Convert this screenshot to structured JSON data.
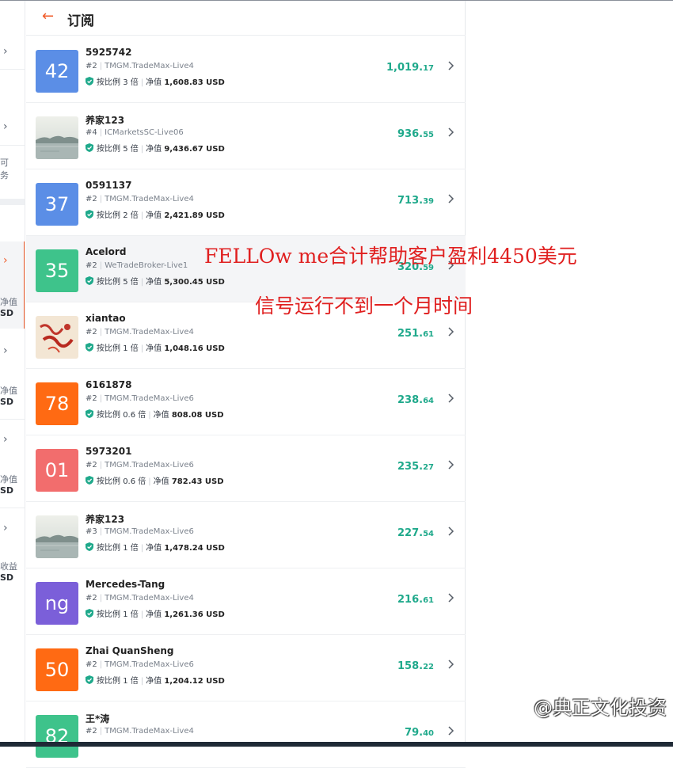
{
  "header": {
    "title": "订阅",
    "back_icon": "arrow-left-icon"
  },
  "labels": {
    "ratio_prefix": "按比例",
    "ratio_suffix": "倍",
    "equity_label": "净值"
  },
  "colors": {
    "accent": "#f05a28",
    "profit": "#1fa98b",
    "annotation": "#e02020"
  },
  "left_panel": {
    "frag_1": "可",
    "frag_2": "务",
    "frag_3": "净值",
    "frag_4": "SD",
    "frag_5": "净值",
    "frag_6": "SD",
    "frag_7": "净值",
    "frag_8": "SD",
    "frag_9": "收益",
    "frag_10": "SD"
  },
  "subscriptions": [
    {
      "avatar": "42",
      "avatar_color": "#5b8ee6",
      "name": "5925742",
      "rank": "#2",
      "server": "TMGM.TradeMax-Live4",
      "ratio": "3",
      "equity": "1,608.83 USD",
      "profit_int": "1,019.",
      "profit_dec": "17"
    },
    {
      "avatar": "photo-lake",
      "name": "养家123",
      "rank": "#4",
      "server": "ICMarketsSC-Live06",
      "ratio": "5",
      "equity": "9,436.67 USD",
      "profit_int": "936.",
      "profit_dec": "55"
    },
    {
      "avatar": "37",
      "avatar_color": "#5b8ee6",
      "name": "0591137",
      "rank": "#2",
      "server": "TMGM.TradeMax-Live4",
      "ratio": "2",
      "equity": "2,421.89 USD",
      "profit_int": "713.",
      "profit_dec": "39"
    },
    {
      "avatar": "35",
      "avatar_color": "#3ec38b",
      "name": "Acelord",
      "rank": "#2",
      "server": "WeTradeBroker-Live1",
      "ratio": "5",
      "equity": "5,300.45 USD",
      "profit_int": "320.",
      "profit_dec": "59"
    },
    {
      "avatar": "photo-calligraphy",
      "name": "xiantao",
      "rank": "#2",
      "server": "TMGM.TradeMax-Live4",
      "ratio": "1",
      "equity": "1,048.16 USD",
      "profit_int": "251.",
      "profit_dec": "61"
    },
    {
      "avatar": "78",
      "avatar_color": "#ff6a13",
      "name": "6161878",
      "rank": "#2",
      "server": "TMGM.TradeMax-Live6",
      "ratio": "0.6",
      "equity": "808.08 USD",
      "profit_int": "238.",
      "profit_dec": "64"
    },
    {
      "avatar": "01",
      "avatar_color": "#f26d6d",
      "name": "5973201",
      "rank": "#2",
      "server": "TMGM.TradeMax-Live6",
      "ratio": "0.6",
      "equity": "782.43 USD",
      "profit_int": "235.",
      "profit_dec": "27"
    },
    {
      "avatar": "photo-lake",
      "name": "养家123",
      "rank": "#3",
      "server": "TMGM.TradeMax-Live6",
      "ratio": "1",
      "equity": "1,478.24 USD",
      "profit_int": "227.",
      "profit_dec": "54"
    },
    {
      "avatar": "ng",
      "avatar_color": "#7b5fd9",
      "name": "Mercedes-Tang",
      "rank": "#2",
      "server": "TMGM.TradeMax-Live4",
      "ratio": "1",
      "equity": "1,261.36 USD",
      "profit_int": "216.",
      "profit_dec": "61"
    },
    {
      "avatar": "50",
      "avatar_color": "#ff6a13",
      "name": "Zhai QuanSheng",
      "rank": "#2",
      "server": "TMGM.TradeMax-Live6",
      "ratio": "1",
      "equity": "1,204.12 USD",
      "profit_int": "158.",
      "profit_dec": "22"
    },
    {
      "avatar": "82",
      "avatar_color": "#3ec38b",
      "name": "王*涛",
      "rank": "#2",
      "server": "TMGM.TradeMax-Live4",
      "ratio": "",
      "equity": "",
      "profit_int": "79.",
      "profit_dec": "40"
    }
  ],
  "annotation": {
    "line1": "FELLOw me合计帮助客户盈利4450美元",
    "line2": "信号运行不到一个月时间"
  },
  "watermark": "@典正文化投资"
}
